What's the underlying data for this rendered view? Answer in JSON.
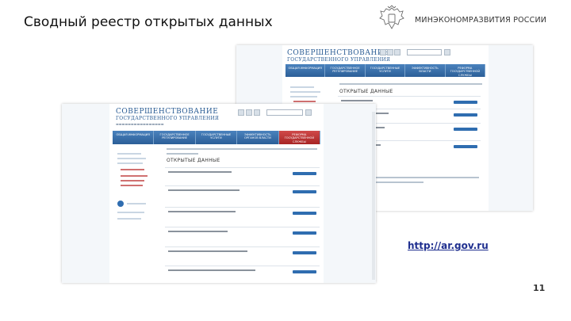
{
  "slide": {
    "title": "Сводный реестр открытых данных",
    "ministry": "МИНЭКОНОМРАЗВИТИЯ РОССИИ",
    "url": "http://ar.gov.ru",
    "page_number": "11"
  },
  "screenshot_back": {
    "logo_line1": "СОВЕРШЕНСТВОВАНИЕ",
    "logo_line2": "ГОСУДАРСТВЕННОГО УПРАВЛЕНИЯ",
    "nav": [
      "ОБЩАЯ ИНФОРМАЦИЯ",
      "ГОСУДАРСТВЕННОЕ РЕГУЛИРОВАНИЕ",
      "ГОСУДАРСТВЕННЫЕ УСЛУГИ",
      "ЭФФЕКТИВНОСТЬ ВЛАСТИ",
      "РЕФОРМА ГОСУДАРСТВЕННОЙ СЛУЖБЫ"
    ],
    "section_title": "ОТКРЫТЫЕ ДАННЫЕ",
    "rows": 4
  },
  "screenshot_front": {
    "logo_line1": "СОВЕРШЕНСТВОВАНИЕ",
    "logo_line2": "ГОСУДАРСТВЕННОГО УПРАВЛЕНИЯ",
    "nav": [
      "ОБЩАЯ ИНФОРМАЦИЯ",
      "ГОСУДАРСТВЕННОЕ РЕГУЛИРОВАНИЕ",
      "ГОСУДАРСТВЕННЫЕ УСЛУГИ",
      "ЭФФЕКТИВНОСТЬ ОРГАНОВ ВЛАСТИ",
      "РЕФОРМА ГОСУДАРСТВЕННОЙ СЛУЖБЫ"
    ],
    "section_title": "ОТКРЫТЫЕ ДАННЫЕ",
    "rows": 6
  }
}
